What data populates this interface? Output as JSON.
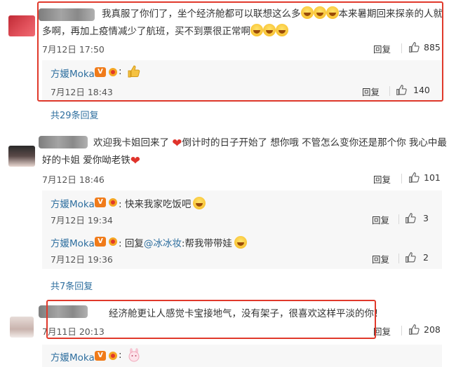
{
  "comments": [
    {
      "text_lines": [
        "我真服了你们了，坐个经济舱都可以联想这么多",
        "本来暑期回来探亲的人就",
        "多啊，再加上疫情减少了航班，买不到票很正常啊"
      ],
      "time": "7月12日 17:50",
      "reply_label": "回复",
      "likes": "885",
      "replies": [
        {
          "name": "方媛Moka",
          "text": "",
          "time": "7月12日 18:43",
          "reply_label": "回复",
          "likes": "140"
        }
      ],
      "more": "共29条回复"
    },
    {
      "text_lines": [
        "欢迎我卡姐回来了",
        "倒计时的日子开始了 想你哦 不管怎么变你还是那个你 我心中最",
        "好的卡姐 爱你呦老铁"
      ],
      "time": "7月12日 18:46",
      "reply_label": "回复",
      "likes": "101",
      "replies": [
        {
          "name": "方媛Moka",
          "text": "快来我家吃饭吧",
          "time": "7月12日 19:34",
          "reply_label": "回复",
          "likes": "3"
        },
        {
          "name": "方媛Moka",
          "text_prefix": "回复",
          "mention": "@冰冰妆",
          "text": ":帮我带带娃",
          "time": "7月12日 19:36",
          "reply_label": "回复",
          "likes": "2"
        }
      ],
      "more": "共7条回复"
    },
    {
      "text_lines": [
        "经济舱更让人感觉卡宝接地气，没有架子，很喜欢这样平淡的你！"
      ],
      "time": "7月11日 20:13",
      "reply_label": "回复",
      "likes": "208",
      "replies": [
        {
          "name": "方媛Moka",
          "text": ""
        }
      ]
    }
  ],
  "badges": {
    "verified": "V"
  },
  "colors": {
    "highlight": "#e0392b",
    "link": "#2f6f9f",
    "vip_badge": "#f07b1a"
  }
}
